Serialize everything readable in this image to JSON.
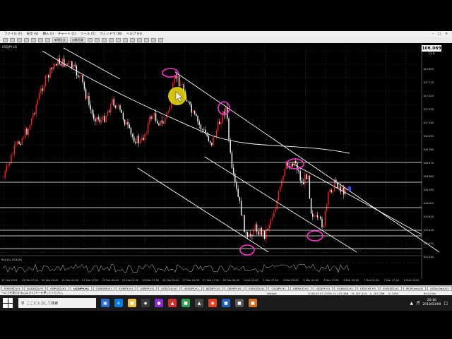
{
  "menu": [
    "ファイル (F)",
    "表示 (V)",
    "挿入 (I)",
    "チャート (C)",
    "ツール (T)",
    "ウィンドウ (W)",
    "ヘルプ (H)"
  ],
  "toolbar": {
    "new_order": "新規注文",
    "auto_trade": "自動売買"
  },
  "chart": {
    "symbol": "USDJPY,H1",
    "current_price": "106.069",
    "spread": "11.4",
    "rsi_label": "RSI(14) 33.8291",
    "price_labels": [
      "107.900",
      "107.710",
      "107.520",
      "107.330",
      "107.140",
      "106.950",
      "106.760",
      "106.570",
      "106.380",
      "106.190",
      "106.000",
      "105.810",
      "105.620",
      "105.430",
      "105.240"
    ],
    "time_labels": [
      "19 Feb 2018",
      "19 Feb 17:00",
      "20 Feb 09:00",
      "21 Feb 01:00",
      "21 Feb 17:00",
      "22 Feb 09:00",
      "23 Feb 01:00",
      "23 Feb 17:00",
      "26 Feb 09:00",
      "27 Feb 01:00",
      "27 Feb 17:00",
      "28 Feb 09:00",
      "1 Mar 01:00",
      "1 Mar 17:00",
      "2 Mar 09:00",
      "5 Mar 01:00",
      "5 Mar 17:00",
      "6 Mar 09:00",
      "7 Mar 01:00",
      "7 Mar 17:00",
      "8 Mar 09:00"
    ],
    "colors": {
      "bull": "#ff2020",
      "bear": "#ffffff",
      "annotation": "#ff30d0",
      "highlight": "#f0e010"
    }
  },
  "tabs": [
    "EURUSD,H1",
    "AUDUSD,H1",
    "GBPUSD,H1",
    "USDJPY,H1",
    "EURGBP,H1",
    "EURJPY,H1",
    "GBPJPY,H1",
    "USDCAD,H1",
    "AUDJPY,H1",
    "NZDJPY,H1",
    "GBPJPY,H1",
    "EURUSD,H1",
    "CADJPY,H1",
    "GBPAUD,H1",
    "USDJPY,H1",
    "EURAUD,H1",
    "USDCHF,H1",
    "EURUSD,H1",
    "JPCHCash,H1",
    "USDxCash,H1",
    "EURUSD,H1"
  ],
  "active_tab": "USDJPY,H1",
  "status": {
    "help": "ヘルプを表示するには [F1] キーを押してください。",
    "profile": "Default",
    "time": "2018.03.07 13:00",
    "open": "O: 107.286",
    "high": "H: 107.424",
    "low": "L: 107.286",
    "vol": "V: 3253",
    "conn": "691/4 kb"
  },
  "taskbar": {
    "search_placeholder": "ここに入力して検索",
    "time": "20:16",
    "date": "2018/03/09"
  }
}
